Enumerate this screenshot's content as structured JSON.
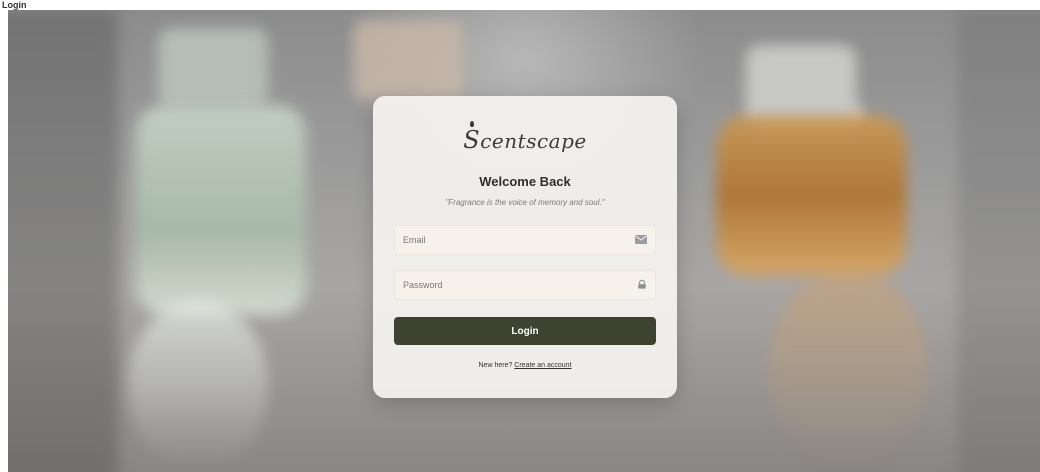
{
  "page": {
    "tab_label": "Login"
  },
  "brand": {
    "logo_initial": "S",
    "logo_rest": "centscape"
  },
  "login_card": {
    "title": "Welcome Back",
    "quote": "\"Fragrance is the voice of memory and soul.\"",
    "email": {
      "placeholder": "Email",
      "value": "",
      "icon": "envelope-icon"
    },
    "password": {
      "placeholder": "Password",
      "value": "",
      "icon": "lock-icon"
    },
    "login_label": "Login",
    "signup_prompt": "New here? ",
    "signup_link": "Create an account"
  },
  "colors": {
    "button_bg": "#3e4331",
    "button_text": "#ffffff",
    "field_bg": "#f6f1ea",
    "card_bg": "#f4f3f0"
  }
}
